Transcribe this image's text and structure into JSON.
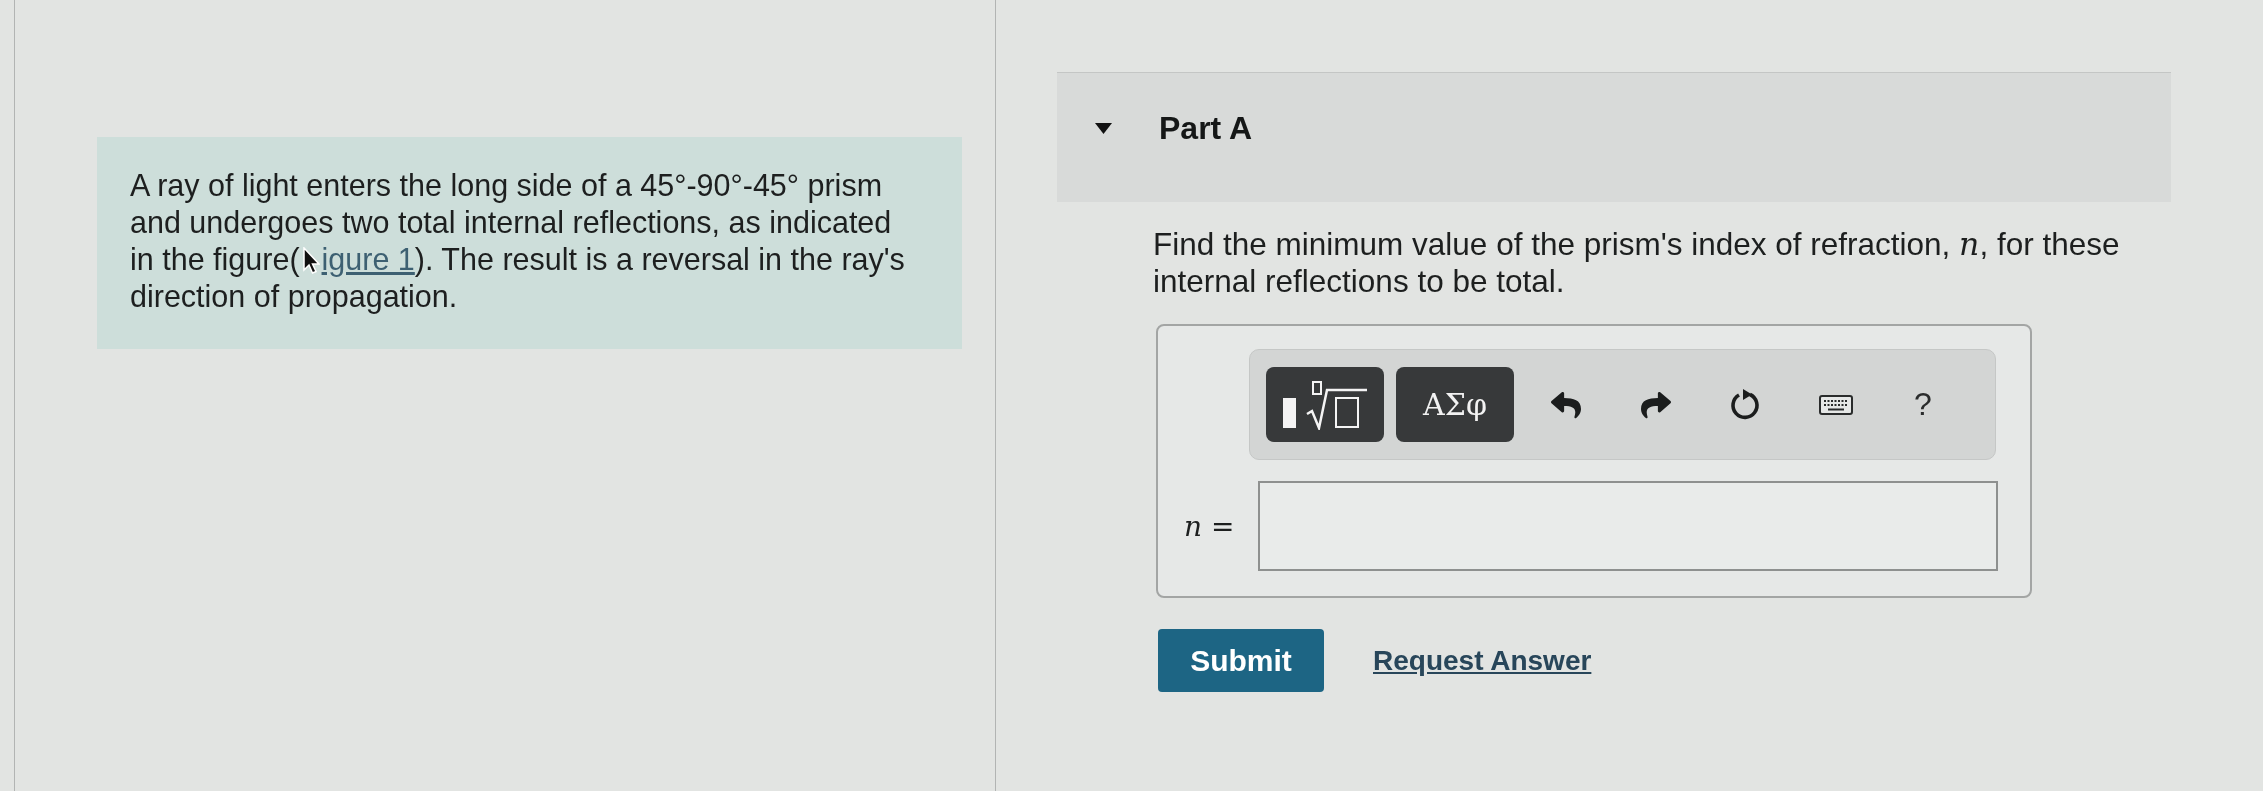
{
  "intro": {
    "text_before": "A ray of light enters the long side of a 45°-90°-45° prism and undergoes two total internal reflections, as indicated in the figure(",
    "link": "igure 1",
    "text_after": "). The result is a reversal in the ray's direction of propagation."
  },
  "part": {
    "title": "Part A",
    "expanded": true,
    "question": "Find the minimum value of the prism's index of refraction, *n*, for these internal reflections to be total.",
    "toolbar": [
      {
        "kind": "templates"
      },
      {
        "kind": "symbols",
        "label": "ΑΣφ"
      },
      {
        "kind": "undo"
      },
      {
        "kind": "redo"
      },
      {
        "kind": "reset"
      },
      {
        "kind": "keyboard"
      },
      {
        "kind": "help",
        "label": "?"
      }
    ],
    "answer": {
      "label": "*n* ="
    },
    "actions": {
      "submit": "Submit",
      "request": "Request Answer"
    }
  }
}
